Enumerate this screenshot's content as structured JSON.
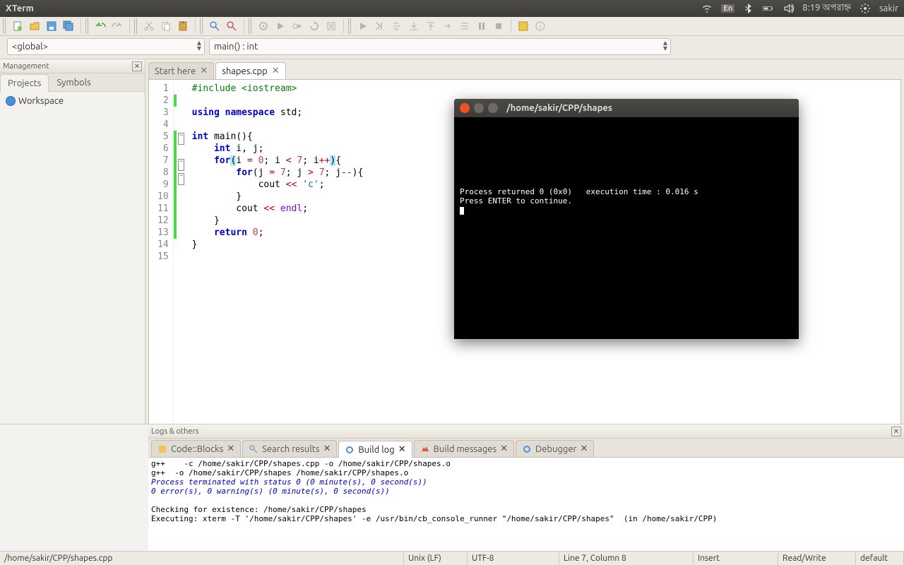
{
  "menubar": {
    "title": "XTerm",
    "lang": "En",
    "time": "8:19 অপরাহ্ন",
    "user": "sakir"
  },
  "scope_combo": "<global>",
  "func_combo": "main() : int",
  "management_title": "Management",
  "side_tabs": {
    "projects": "Projects",
    "symbols": "Symbols"
  },
  "workspace_label": "Workspace",
  "editor_tabs": [
    {
      "label": "Start here",
      "active": false
    },
    {
      "label": "shapes.cpp",
      "active": true
    }
  ],
  "code_lines": [
    {
      "n": 1,
      "html": "<span class='pp'>#include &lt;iostream&gt;</span>"
    },
    {
      "n": 2,
      "html": ""
    },
    {
      "n": 3,
      "html": "<span class='kw'>using</span> <span class='kw'>namespace</span> <span class='id'>std</span>;"
    },
    {
      "n": 4,
      "html": ""
    },
    {
      "n": 5,
      "html": "<span class='kw'>int</span> <span class='fn'>main</span>(){"
    },
    {
      "n": 6,
      "html": "    <span class='kw'>int</span> i, j;"
    },
    {
      "n": 7,
      "html": "    <span class='kw'>for</span><span class='hlparen'>(</span>i <span class='op'>=</span> <span class='num'>0</span>; i <span class='op'>&lt;</span> <span class='num'>7</span>; i<span class='op'>++</span><span class='hlparen'>)</span>{"
    },
    {
      "n": 8,
      "html": "        <span class='kw'>for</span>(j <span class='op'>=</span> <span class='num'>7</span>; j <span class='op'>&gt;</span> <span class='num'>7</span>; j<span class='op'>--</span>){"
    },
    {
      "n": 9,
      "html": "            cout <span class='op'>&lt;&lt;</span> <span class='str'>'c'</span>;"
    },
    {
      "n": 10,
      "html": "        }"
    },
    {
      "n": 11,
      "html": "        cout <span class='op'>&lt;&lt;</span> <span class='endl'>endl</span>;"
    },
    {
      "n": 12,
      "html": "    }"
    },
    {
      "n": 13,
      "html": "    <span class='kw'>return</span> <span class='num'>0</span>;"
    },
    {
      "n": 14,
      "html": "}"
    },
    {
      "n": 15,
      "html": ""
    }
  ],
  "logs_title": "Logs & others",
  "log_tabs": {
    "codeblocks": "Code::Blocks",
    "search": "Search results",
    "build": "Build log",
    "msgs": "Build messages",
    "dbg": "Debugger"
  },
  "build_log": {
    "l1": "g++    -c /home/sakir/CPP/shapes.cpp -o /home/sakir/CPP/shapes.o",
    "l2": "g++  -o /home/sakir/CPP/shapes /home/sakir/CPP/shapes.o",
    "l3": "Process terminated with status 0 (0 minute(s), 0 second(s))",
    "l4": "0 error(s), 0 warning(s) (0 minute(s), 0 second(s))",
    "l5": "",
    "l6": "Checking for existence: /home/sakir/CPP/shapes",
    "l7": "Executing: xterm -T '/home/sakir/CPP/shapes' -e /usr/bin/cb_console_runner \"/home/sakir/CPP/shapes\"  (in /home/sakir/CPP)"
  },
  "status": {
    "path": "/home/sakir/CPP/shapes.cpp",
    "eol": "Unix (LF)",
    "enc": "UTF-8",
    "pos": "Line 7, Column 8",
    "ins": "Insert",
    "rw": "Read/Write",
    "prof": "default"
  },
  "terminal": {
    "title": "/home/sakir/CPP/shapes",
    "out1": "Process returned 0 (0x0)   execution time : 0.016 s",
    "out2": "Press ENTER to continue."
  }
}
